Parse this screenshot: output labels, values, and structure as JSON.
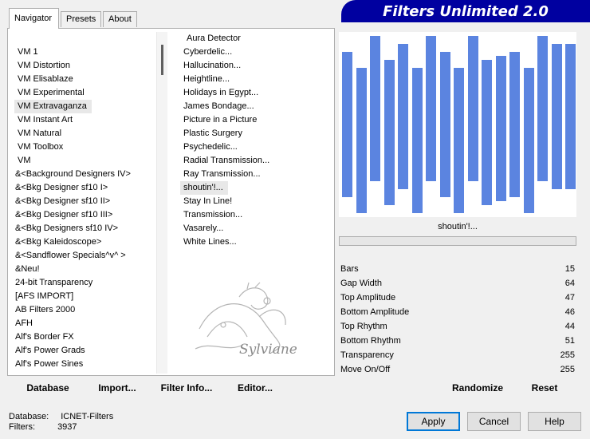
{
  "tabs": [
    "Navigator",
    "Presets",
    "About"
  ],
  "banner": "Filters Unlimited 2.0",
  "categories": [
    "VM 1",
    "VM Distortion",
    "VM Elisablaze",
    "VM Experimental",
    "VM Extravaganza",
    "VM Instant Art",
    "VM Natural",
    "VM Toolbox",
    "VM",
    "&<Background Designers IV>",
    "&<Bkg Designer sf10 I>",
    "&<Bkg Designer sf10 II>",
    "&<Bkg Designer sf10 III>",
    "&<Bkg Designers sf10 IV>",
    "&<Bkg Kaleidoscope>",
    "&<Sandflower Specials^v^ >",
    "&Neu!",
    "24-bit Transparency",
    "[AFS IMPORT]",
    "AB Filters 2000",
    "AFH",
    "Alf's Border FX",
    "Alf's Power Grads",
    "Alf's Power Sines"
  ],
  "selected_category": "VM Extravaganza",
  "filters": [
    "Aura Detector",
    "Cyberdelic...",
    "Hallucination...",
    "Heightline...",
    "Holidays in Egypt...",
    "James Bondage...",
    "Picture in a Picture",
    "Plastic Surgery",
    "Psychedelic...",
    "Radial Transmission...",
    "Ray Transmission...",
    "shoutin'!...",
    "Stay In Line!",
    "Transmission...",
    "Vasarely...",
    "White Lines..."
  ],
  "selected_filter": "shoutin'!...",
  "watermark": "Sylviane",
  "actions": {
    "database": "Database",
    "import": "Import...",
    "filter_info": "Filter Info...",
    "editor": "Editor..."
  },
  "preview": {
    "filter_name": "shoutin'!...",
    "bar_color": "#5b84e0"
  },
  "params": [
    {
      "label": "Bars",
      "value": "15"
    },
    {
      "label": "Gap Width",
      "value": "64"
    },
    {
      "label": "Top Amplitude",
      "value": "47"
    },
    {
      "label": "Bottom Amplitude",
      "value": "46"
    },
    {
      "label": "Top Rhythm",
      "value": "44"
    },
    {
      "label": "Bottom Rhythm",
      "value": "51"
    },
    {
      "label": "Transparency",
      "value": "255"
    },
    {
      "label": "Move On/Off",
      "value": "255"
    }
  ],
  "param_buttons": {
    "randomize": "Randomize",
    "reset": "Reset"
  },
  "status": {
    "database_label": "Database:",
    "database_value": "ICNET-Filters",
    "filters_label": "Filters:",
    "filters_value": "3937"
  },
  "dialog": {
    "apply": "Apply",
    "cancel": "Cancel",
    "help": "Help"
  }
}
